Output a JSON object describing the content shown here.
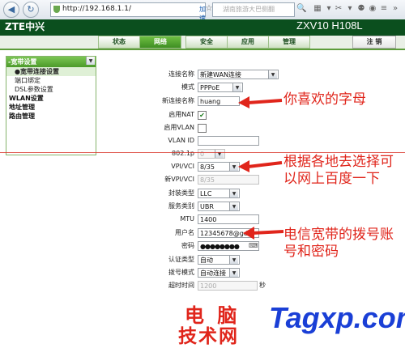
{
  "browser": {
    "url": "http://192.168.1.1/",
    "speed_label": "加速器",
    "search_placeholder": "湖南旅游大巴侧翻"
  },
  "router": {
    "brand": "ZTE中兴",
    "model": "ZXV10 H108L",
    "tabs": [
      {
        "label": "状态"
      },
      {
        "label": "网络"
      },
      {
        "label": "安全"
      },
      {
        "label": "应用"
      },
      {
        "label": "管理"
      }
    ],
    "logout_label": "注 销"
  },
  "sidebar": {
    "header": "-宽带设置",
    "items": [
      {
        "label": "●宽带连接设置"
      },
      {
        "label": "端口绑定"
      },
      {
        "label": "DSL参数设置"
      }
    ],
    "categories": [
      {
        "label": "WLAN设置"
      },
      {
        "label": "地址管理"
      },
      {
        "label": "路由管理"
      }
    ]
  },
  "form": {
    "conn_name_label": "连接名称",
    "conn_name_value": "新建WAN连接",
    "mode_label": "模式",
    "mode_value": "PPPoE",
    "new_name_label": "新连接名称",
    "new_name_value": "huang",
    "nat_label": "启用NAT",
    "nat_checked": "✔",
    "vlan_label": "启用VLAN",
    "vlan_id_label": "VLAN ID",
    "p8021_label": "802.1p",
    "p8021_value": "0",
    "vpi_label": "VPI/VCI",
    "vpi_value": "8/35",
    "new_vpi_label": "新VPI/VCI",
    "new_vpi_value": "8/35",
    "encap_label": "封装类型",
    "encap_value": "LLC",
    "service_label": "服务类别",
    "service_value": "UBR",
    "mtu_label": "MTU",
    "mtu_value": "1400",
    "user_label": "用户名",
    "user_value": "12345678@gd",
    "pwd_label": "密码",
    "pwd_value": "●●●●●●●●",
    "auth_label": "认证类型",
    "auth_value": "自动",
    "dial_label": "拨号模式",
    "dial_value": "自动连接",
    "timeout_label": "超时时间",
    "timeout_value": "1200",
    "timeout_unit": "秒"
  },
  "annotations": {
    "note1": "你喜欢的字母",
    "note2_line1": "根据各地去选择可",
    "note2_line2": "以网上百度一下",
    "note3_line1": "电信宽带的拨号账",
    "note3_line2": "号和密码",
    "color": "#e0251b"
  },
  "watermark": {
    "line1": "电 脑",
    "line2": "技术网",
    "site": "Tagxp.com"
  }
}
